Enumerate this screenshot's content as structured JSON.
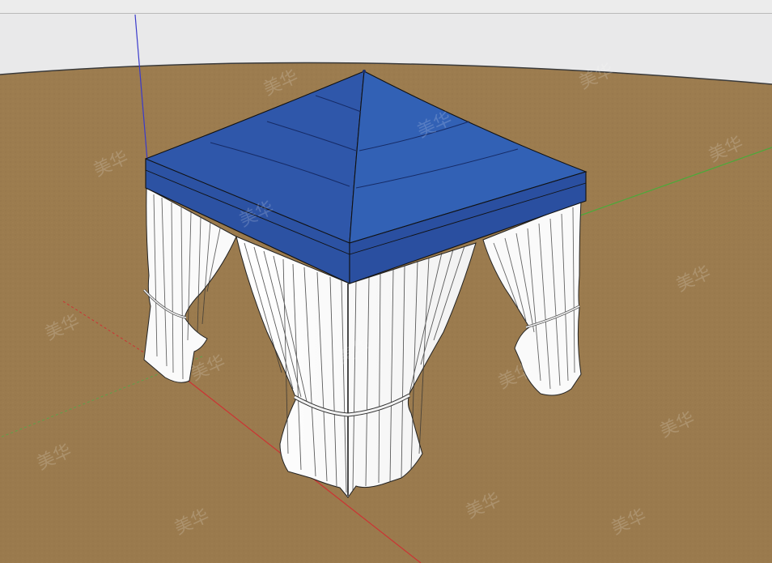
{
  "scene": {
    "colors": {
      "sky": "#e9e9ea",
      "ground": "#9a7b4f",
      "canopy": "#2f56a8",
      "canopy_dark": "#27489a",
      "curtain": "#ffffff",
      "curtain_shadow": "#2a2a2a",
      "axis_blue": "#3a3acc",
      "axis_green": "#4caa3a",
      "axis_red": "#cc3333"
    },
    "watermark_text": "美华",
    "object": "pavilion-tent-model"
  }
}
